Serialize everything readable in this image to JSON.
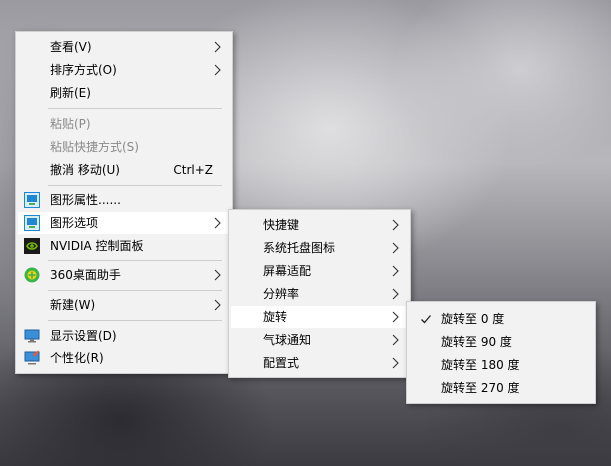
{
  "desktop_menu": {
    "items": [
      {
        "label": "查看(V)"
      },
      {
        "label": "排序方式(O)"
      },
      {
        "label": "刷新(E)"
      },
      {
        "label": "粘贴(P)"
      },
      {
        "label": "粘贴快捷方式(S)"
      },
      {
        "label": "撤消 移动(U)",
        "shortcut": "Ctrl+Z"
      },
      {
        "label": "图形属性......",
        "icon": "intel-graphics-icon"
      },
      {
        "label": "图形选项",
        "icon": "intel-graphics-icon"
      },
      {
        "label": "NVIDIA 控制面板",
        "icon": "nvidia-icon"
      },
      {
        "label": "360桌面助手",
        "icon": "360-assistant-icon"
      },
      {
        "label": "新建(W)"
      },
      {
        "label": "显示设置(D)",
        "icon": "display-settings-icon"
      },
      {
        "label": "个性化(R)",
        "icon": "personalize-icon"
      }
    ]
  },
  "graphics_options_menu": {
    "items": [
      {
        "label": "快捷键"
      },
      {
        "label": "系统托盘图标"
      },
      {
        "label": "屏幕适配"
      },
      {
        "label": "分辨率"
      },
      {
        "label": "旋转"
      },
      {
        "label": "气球通知"
      },
      {
        "label": "配置式"
      }
    ]
  },
  "rotation_menu": {
    "items": [
      {
        "label": "旋转至 0 度",
        "checked": true
      },
      {
        "label": "旋转至 90 度"
      },
      {
        "label": "旋转至 180 度"
      },
      {
        "label": "旋转至 270 度"
      }
    ]
  },
  "colors": {
    "menu_bg": "#f2f2f2",
    "highlight": "#ffffff",
    "disabled_text": "#8a8a8a",
    "separator": "#cdcdcd",
    "nvidia_green": "#76b900",
    "intel_blue": "#1e88d6"
  }
}
